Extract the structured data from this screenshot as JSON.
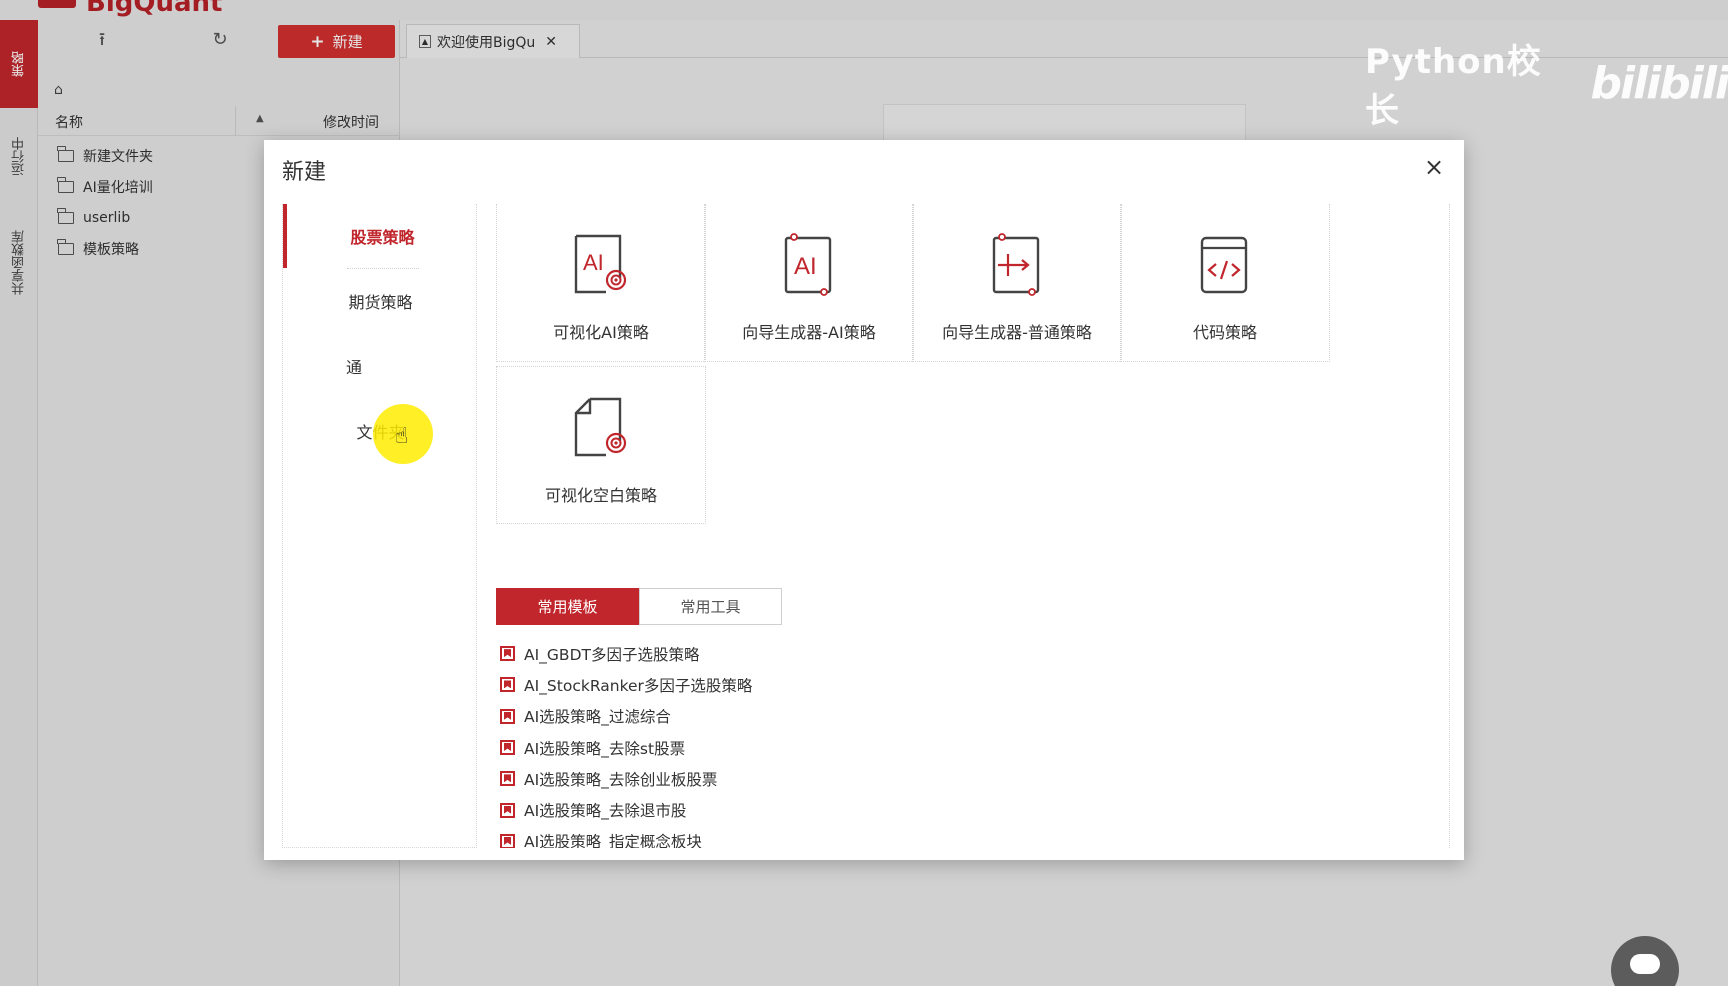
{
  "app": {
    "logo_text": "BigQuant"
  },
  "side_tabs": [
    {
      "label": "策略",
      "active": true
    },
    {
      "label": "运行中",
      "active": false
    },
    {
      "label": "共享函数库",
      "active": false
    }
  ],
  "toolbar": {
    "upload_icon": "upload-icon",
    "refresh_icon": "refresh-icon",
    "new_label": "新建"
  },
  "file_list": {
    "col_name": "名称",
    "col_time": "修改时间",
    "items": [
      {
        "label": "新建文件夹"
      },
      {
        "label": "AI量化培训"
      },
      {
        "label": "userlib"
      },
      {
        "label": "模板策略"
      }
    ]
  },
  "doc_tabs": [
    {
      "label": "欢迎使用BigQu",
      "close": "✕"
    }
  ],
  "watermark": {
    "text": "Python校长",
    "brand": "bilibili"
  },
  "modal": {
    "title": "新建",
    "close": "×",
    "categories": [
      {
        "label": "股票策略",
        "active": true
      },
      {
        "label": "期货策略",
        "active": false
      },
      {
        "label": "通",
        "active": false
      },
      {
        "label": "文件夹",
        "active": false
      }
    ],
    "cards": [
      {
        "label": "可视化AI策略",
        "icon": "visual-ai-strategy-icon"
      },
      {
        "label": "向导生成器-AI策略",
        "icon": "wizard-ai-icon"
      },
      {
        "label": "向导生成器-普通策略",
        "icon": "wizard-plain-icon"
      },
      {
        "label": "代码策略",
        "icon": "code-icon"
      },
      {
        "label": "可视化空白策略",
        "icon": "visual-blank-icon"
      }
    ],
    "template_tabs": [
      {
        "label": "常用模板",
        "active": true
      },
      {
        "label": "常用工具",
        "active": false
      }
    ],
    "templates": [
      {
        "label": "AI_GBDT多因子选股策略"
      },
      {
        "label": "AI_StockRanker多因子选股策略"
      },
      {
        "label": "AI选股策略_过滤综合"
      },
      {
        "label": "AI选股策略_去除st股票"
      },
      {
        "label": "AI选股策略_去除创业板股票"
      },
      {
        "label": "AI选股策略_去除退市股"
      },
      {
        "label": "AI选股策略_指定概念板块"
      }
    ]
  },
  "colors": {
    "accent": "#c0262c",
    "new_button": "#d32f2f"
  }
}
